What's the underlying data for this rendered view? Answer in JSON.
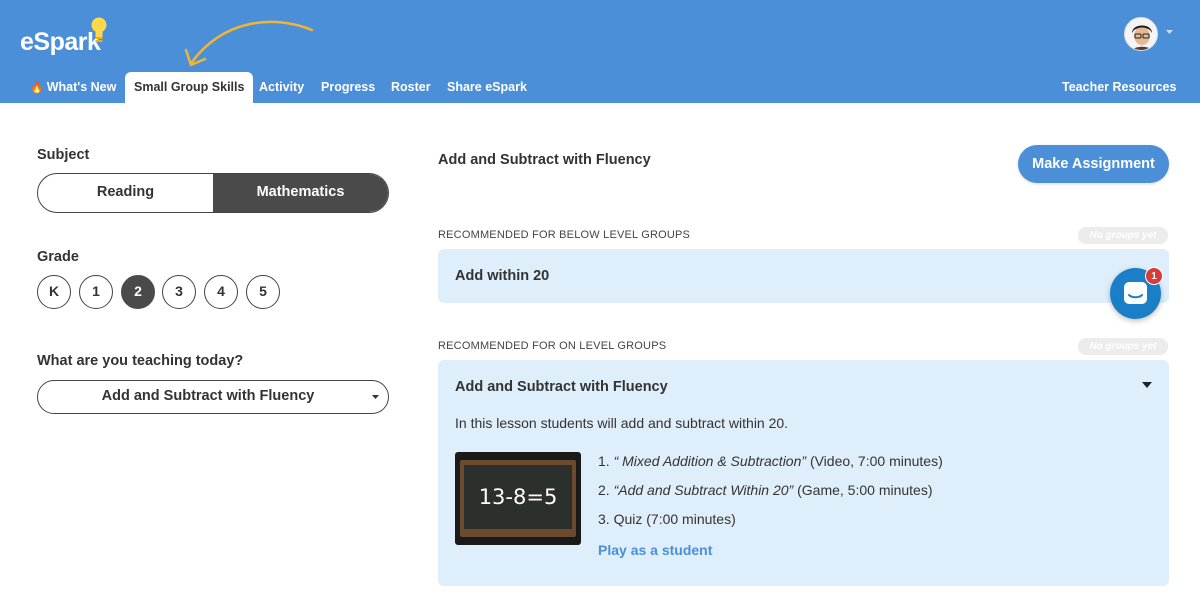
{
  "brand": {
    "logo_text": "eSpark"
  },
  "nav": {
    "items": [
      {
        "label": "What's New",
        "icon": "fire-icon"
      },
      {
        "label": "Small Group Skills"
      },
      {
        "label": "Activity"
      },
      {
        "label": "Progress"
      },
      {
        "label": "Roster"
      },
      {
        "label": "Share eSpark"
      }
    ],
    "active": "Small Group Skills",
    "teacher_resources": "Teacher Resources"
  },
  "filters": {
    "subject_label": "Subject",
    "subjects": [
      "Reading",
      "Mathematics"
    ],
    "selected_subject": "Mathematics",
    "grade_label": "Grade",
    "grades": [
      "K",
      "1",
      "2",
      "3",
      "4",
      "5"
    ],
    "selected_grade": "2",
    "teaching_label": "What are you teaching today?",
    "teaching_value": "Add and Subtract with Fluency"
  },
  "lesson": {
    "title": "Add and Subtract with Fluency",
    "make_assignment": "Make Assignment",
    "below_label": "RECOMMENDED FOR BELOW LEVEL GROUPS",
    "below_badge": "No groups yet",
    "below_card_title": "Add within 20",
    "on_label": "RECOMMENDED FOR ON LEVEL GROUPS",
    "on_badge": "No groups yet",
    "on_card_title": "Add and Subtract with Fluency",
    "description": "In this lesson students will add and subtract within 20.",
    "thumbnail_text": "13-8=5",
    "steps": [
      {
        "num": "1.",
        "title": "“ Mixed Addition & Subtraction”",
        "detail": "(Video, 7:00 minutes)"
      },
      {
        "num": "2.",
        "title": "“Add and Subtract Within 20”",
        "detail": "(Game, 5:00 minutes)"
      },
      {
        "num": "3.",
        "title": "",
        "detail": "Quiz (7:00 minutes)"
      }
    ],
    "play_link": "Play as a student"
  },
  "chat": {
    "badge_count": "1"
  },
  "colors": {
    "brand_blue": "#4a8fd8",
    "card_bg": "#dfeefb",
    "selected_dark": "#4a4a4a",
    "badge_red": "#d93a3a"
  }
}
